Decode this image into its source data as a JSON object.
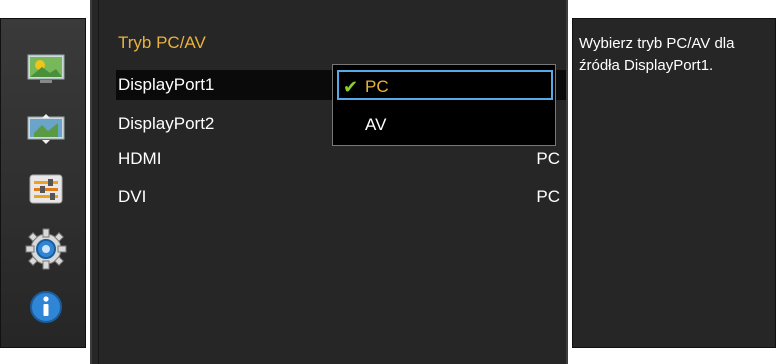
{
  "menu": {
    "title": "Tryb PC/AV",
    "items": [
      {
        "label": "DisplayPort1",
        "value": ""
      },
      {
        "label": "DisplayPort2",
        "value": ""
      },
      {
        "label": "HDMI",
        "value": "PC"
      },
      {
        "label": "DVI",
        "value": "PC"
      }
    ]
  },
  "dropdown": {
    "options": [
      {
        "label": "PC",
        "checkmark": "✔"
      },
      {
        "label": "AV"
      }
    ]
  },
  "help": {
    "text": "Wybierz tryb PC/AV dla źródła DisplayPort1."
  },
  "sidebar": {
    "icons": [
      "picture-icon",
      "screen-size-icon",
      "adjust-sliders-icon",
      "gear-icon",
      "info-icon"
    ]
  },
  "colors": {
    "accent": "#e7b33a",
    "focus_border": "#58a9e8",
    "checkmark": "#8ad02c",
    "panel_bg": "#262626"
  }
}
